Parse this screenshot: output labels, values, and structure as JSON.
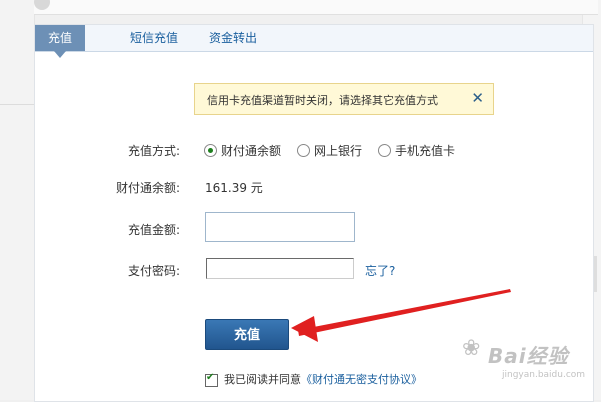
{
  "tabs": [
    {
      "label": "充值",
      "active": true
    },
    {
      "label": "短信充值",
      "active": false
    },
    {
      "label": "资金转出",
      "active": false
    }
  ],
  "notice": {
    "message": "信用卡充值渠道暂时关闭，请选择其它充值方式",
    "close_glyph": "✕"
  },
  "form": {
    "method_label": "充值方式:",
    "methods": [
      {
        "label": "财付通余额",
        "selected": true
      },
      {
        "label": "网上银行",
        "selected": false
      },
      {
        "label": "手机充值卡",
        "selected": false
      }
    ],
    "balance_label": "财付通余额:",
    "balance_value": "161.39 元",
    "amount_label": "充值金额:",
    "amount_value": "",
    "password_label": "支付密码:",
    "password_value": "",
    "forgot_link": "忘了?",
    "submit_label": "充值",
    "agreement_prefix": "我已阅读并同意",
    "agreement_link": "《财付通无密支付协议》",
    "agreement_checked": true
  },
  "annotation": {
    "arrow_color": "#e02020"
  },
  "watermark": {
    "logo_text": "Bai经验",
    "url": "jingyan.baidu.com"
  },
  "colors": {
    "accent": "#6d90b6",
    "link": "#1a5f9e",
    "button": "#21558e"
  }
}
